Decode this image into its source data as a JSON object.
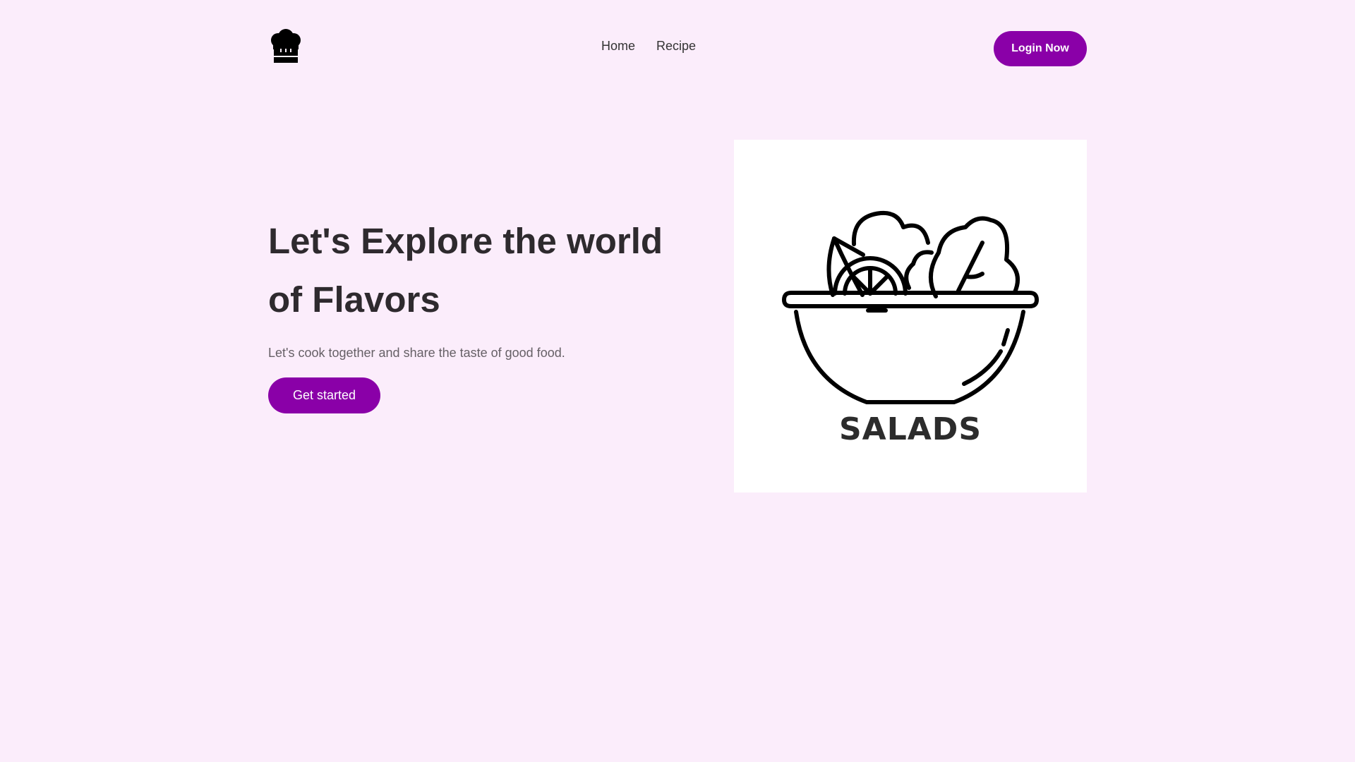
{
  "logo": {
    "icon": "chef-hat-icon"
  },
  "nav": {
    "links": [
      {
        "label": "Home"
      },
      {
        "label": "Recipe"
      }
    ],
    "login_label": "Login Now"
  },
  "hero": {
    "title": "Let's Explore the world of Flavors",
    "subtitle": "Let's cook together and share the taste of good food.",
    "cta_label": "Get started",
    "image": {
      "icon": "salad-bowl-icon",
      "caption": "SALADS"
    }
  },
  "colors": {
    "accent": "#8a00a8",
    "background": "#fbedfb",
    "heading": "#2e2a2e",
    "body_text": "#666066"
  }
}
